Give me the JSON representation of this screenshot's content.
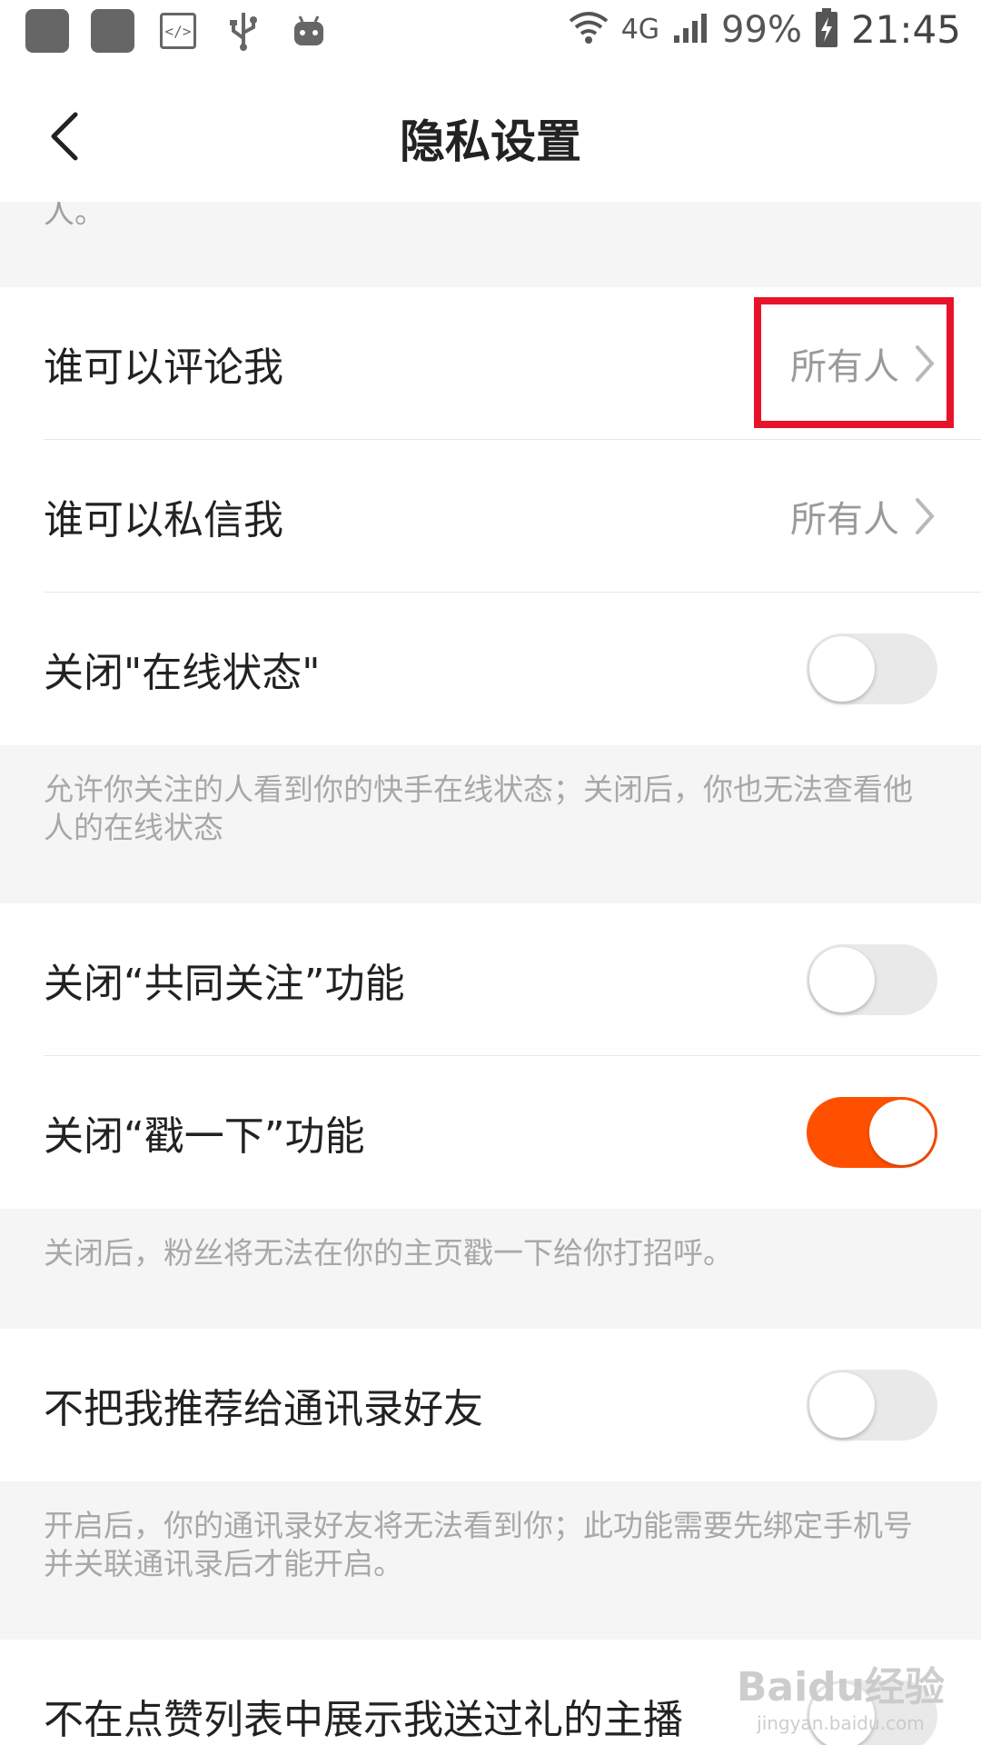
{
  "status_bar": {
    "battery": "99%",
    "time": "21:45",
    "network": "4G",
    "icons": [
      "notification-icon",
      "notification-icon",
      "code-icon",
      "usb-icon",
      "android-icon",
      "wifi-icon",
      "signal-icon",
      "battery-charging-icon"
    ]
  },
  "nav": {
    "title": "隐私设置",
    "back_icon": "back-arrow-icon"
  },
  "top_desc": "人。",
  "settings": {
    "comment": {
      "label": "谁可以评论我",
      "value": "所有人"
    },
    "message": {
      "label": "谁可以私信我",
      "value": "所有人"
    },
    "online_status": {
      "label": "关闭\"在线状态\"",
      "on": false,
      "desc": "允许你关注的人看到你的快手在线状态；关闭后，你也无法查看他人的在线状态"
    },
    "mutual_follow": {
      "label": "关闭“共同关注”功能",
      "on": false
    },
    "poke": {
      "label": "关闭“戳一下”功能",
      "on": true,
      "desc": "关闭后，粉丝将无法在你的主页戳一下给你打招呼。"
    },
    "contacts": {
      "label": "不把我推荐给通讯录好友",
      "on": false,
      "desc": "开启后，你的通讯录好友将无法看到你；此功能需要先绑定手机号并关联通讯录后才能开启。"
    },
    "likes_list": {
      "label": "不在点赞列表中展示我送过礼的主播",
      "on": false
    }
  },
  "colors": {
    "accent": "#ff5000",
    "highlight": "#e8132b"
  },
  "watermark": {
    "logo": "Baidu经验",
    "sub": "jingyan.baidu.com"
  }
}
